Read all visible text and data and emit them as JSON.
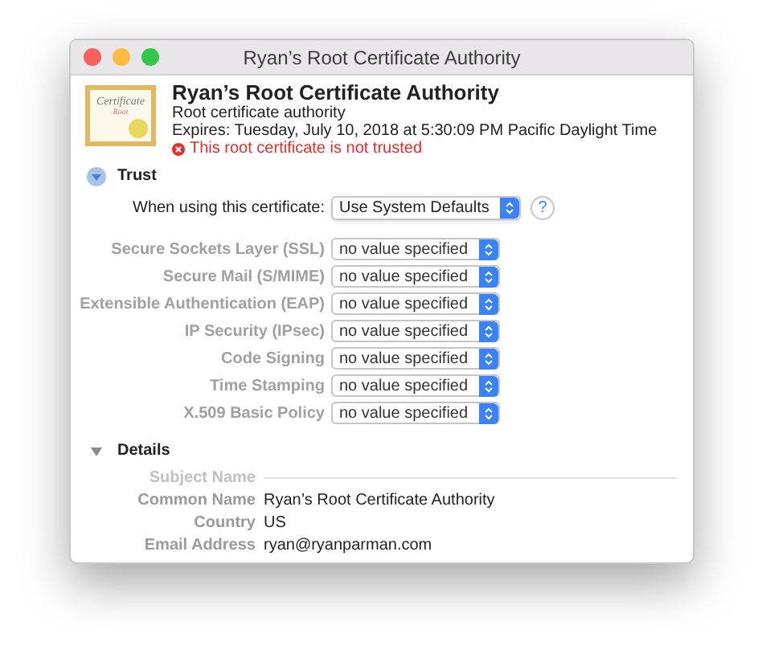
{
  "window": {
    "title": "Ryan’s Root Certificate Authority"
  },
  "header": {
    "icon_texts": [
      "Certificate",
      "Root"
    ],
    "name": "Ryan’s Root Certificate Authority",
    "kind_text": "Root certificate authority",
    "expires": "Expires: Tuesday, July 10, 2018 at 5:30:09 PM Pacific Daylight Time",
    "warning": "This root certificate is not trusted"
  },
  "trust": {
    "title": "Trust",
    "expanded": true,
    "main": {
      "label": "When using this certificate:",
      "value": "Use System Defaults",
      "help": "?"
    },
    "policies": [
      {
        "label": "Secure Sockets Layer (SSL)",
        "value": "no value specified",
        "disabled": true
      },
      {
        "label": "Secure Mail (S/MIME)",
        "value": "no value specified",
        "disabled": true
      },
      {
        "label": "Extensible Authentication (EAP)",
        "value": "no value specified",
        "disabled": true
      },
      {
        "label": "IP Security (IPsec)",
        "value": "no value specified",
        "disabled": true
      },
      {
        "label": "Code Signing",
        "value": "no value specified",
        "disabled": true
      },
      {
        "label": "Time Stamping",
        "value": "no value specified",
        "disabled": true
      },
      {
        "label": "X.509 Basic Policy",
        "value": "no value specified",
        "disabled": true
      }
    ]
  },
  "details": {
    "title": "Details",
    "expanded": true,
    "rows": [
      {
        "kind": "section",
        "label": "Subject Name"
      },
      {
        "kind": "field",
        "label": "Common Name",
        "value": "Ryan’s Root Certificate Authority"
      },
      {
        "kind": "field",
        "label": "Country",
        "value": "US"
      },
      {
        "kind": "field",
        "label": "Email Address",
        "value": "ryan@ryanparman.com"
      }
    ]
  }
}
